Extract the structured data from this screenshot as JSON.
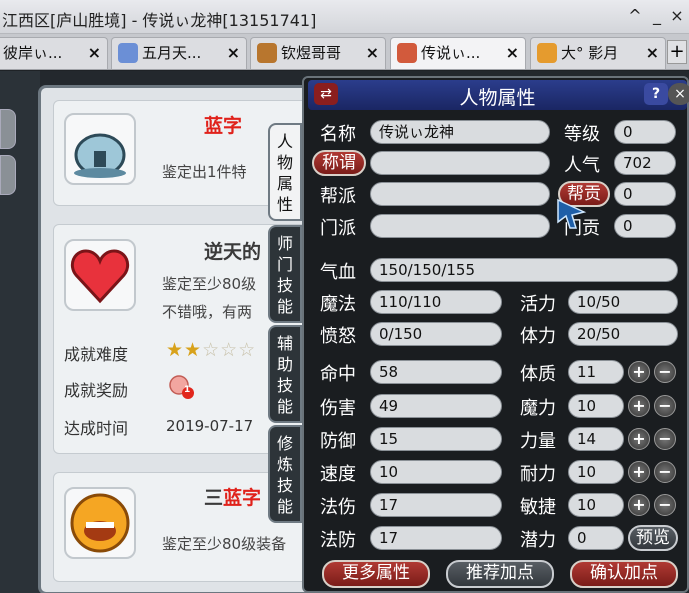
{
  "window": {
    "title": "江西区[庐山胜境] - 传说ぃ龙神[13151741]",
    "buttons": [
      "^",
      "_",
      "×"
    ]
  },
  "tabs": [
    {
      "label": "彼岸ぃ...",
      "close": "×"
    },
    {
      "label": "五月天...",
      "close": "×"
    },
    {
      "label": "钦煜哥哥",
      "close": "×"
    },
    {
      "label": "传说ぃ...",
      "close": "×"
    },
    {
      "label": "大° 影月",
      "close": "×"
    }
  ],
  "new_tab": "+",
  "achievements": [
    {
      "title_prefix": "",
      "title_red": "蓝字",
      "desc": "鉴定出1件特"
    },
    {
      "title": "逆天的",
      "desc1": "鉴定至少80级",
      "desc2": "不错哦，有两",
      "difficulty_label": "成就难度",
      "difficulty_stars": 2,
      "difficulty_max": 5,
      "reward_label": "成就奖励",
      "reward_count": "1",
      "time_label": "达成时间",
      "time_value": "2019-07-17"
    },
    {
      "title_prefix": "三",
      "title_red": "蓝字",
      "desc": "鉴定至少80级装备"
    }
  ],
  "side_tabs": [
    {
      "label": "人物属性"
    },
    {
      "label": "师门技能"
    },
    {
      "label": "辅助技能"
    },
    {
      "label": "修炼技能"
    }
  ],
  "panel": {
    "title": "人物属性",
    "help": "?",
    "close": "×",
    "name_label": "名称",
    "name_value": "传说ぃ龙神",
    "level_label": "等级",
    "level_value": "0",
    "title_btn": "称谓",
    "title_value": "",
    "popularity_label": "人气",
    "popularity_value": "702",
    "gang_label": "帮派",
    "gang_value": "",
    "contrib_btn": "帮贡",
    "contrib_value": "0",
    "sect_label": "门派",
    "sect_value": "",
    "sect_contrib_label": "门贡",
    "sect_contrib_value": "0",
    "hp_label": "气血",
    "hp_value": "150/150/155",
    "mp_label": "魔法",
    "mp_value": "110/110",
    "vitality_label": "活力",
    "vitality_value": "10/50",
    "anger_label": "愤怒",
    "anger_value": "0/150",
    "stamina_label": "体力",
    "stamina_value": "20/50",
    "stats": [
      {
        "label": "命中",
        "value": "58"
      },
      {
        "label": "伤害",
        "value": "49"
      },
      {
        "label": "防御",
        "value": "15"
      },
      {
        "label": "速度",
        "value": "10"
      },
      {
        "label": "法伤",
        "value": "17"
      },
      {
        "label": "法防",
        "value": "17"
      }
    ],
    "attrs": [
      {
        "label": "体质",
        "value": "11"
      },
      {
        "label": "魔力",
        "value": "10"
      },
      {
        "label": "力量",
        "value": "14"
      },
      {
        "label": "耐力",
        "value": "10"
      },
      {
        "label": "敏捷",
        "value": "10"
      }
    ],
    "potential_label": "潜力",
    "potential_value": "0",
    "preview_btn": "预览",
    "plus": "+",
    "minus": "−",
    "more_btn": "更多属性",
    "recommend_btn": "推荐加点",
    "confirm_btn": "确认加点"
  }
}
